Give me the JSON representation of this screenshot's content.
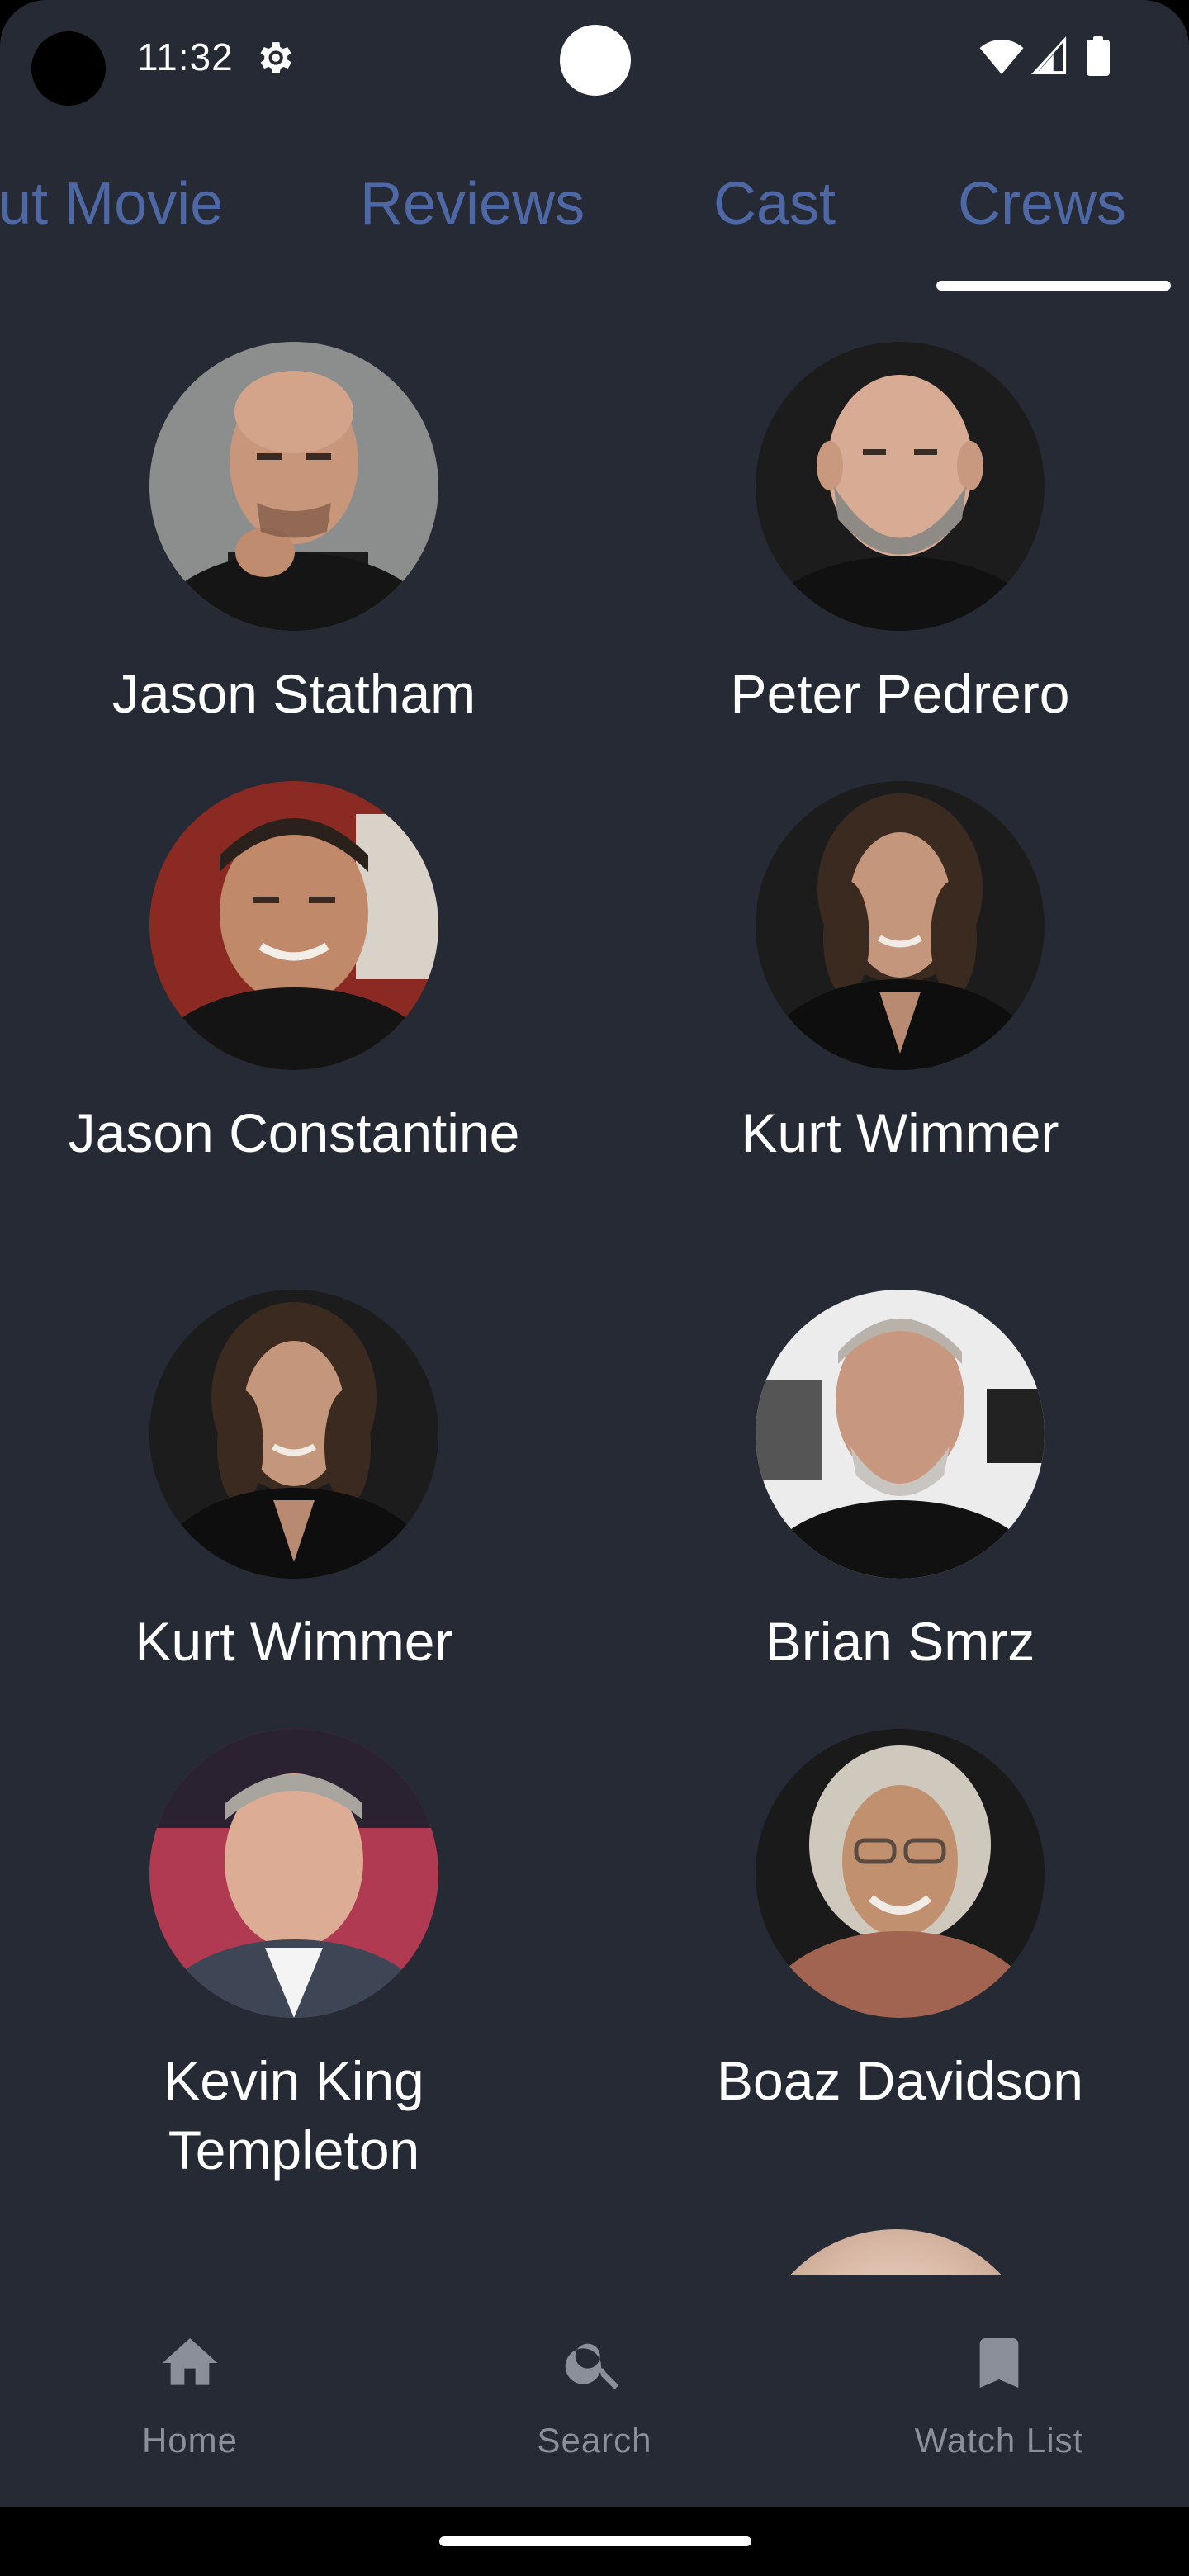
{
  "status_bar": {
    "time": "11:32",
    "icons": [
      "settings-icon",
      "wifi-icon",
      "signal-icon",
      "battery-icon"
    ]
  },
  "tabs": [
    {
      "label": "About Movie",
      "selected": false
    },
    {
      "label": "Reviews",
      "selected": false
    },
    {
      "label": "Cast",
      "selected": false
    },
    {
      "label": "Crews",
      "selected": true
    }
  ],
  "colors": {
    "background": "#252a34",
    "tab_text": "#4e68a6",
    "tab_indicator": "#ffffff",
    "nav_text": "#8a8f99"
  },
  "crew": [
    {
      "name": "Jason Statham"
    },
    {
      "name": "Peter Pedrero"
    },
    {
      "name": "Jason Constantine"
    },
    {
      "name": "Kurt Wimmer"
    },
    {
      "name": "Kurt Wimmer"
    },
    {
      "name": "Brian Smrz"
    },
    {
      "name": "Kevin King Templeton"
    },
    {
      "name": "Boaz Davidson"
    }
  ],
  "bottom_nav": [
    {
      "label": "Home",
      "icon": "home-icon"
    },
    {
      "label": "Search",
      "icon": "search-icon"
    },
    {
      "label": "Watch List",
      "icon": "bookmark-icon"
    }
  ]
}
